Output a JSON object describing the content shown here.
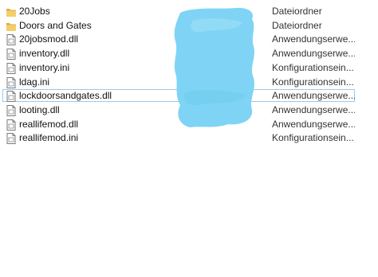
{
  "colors": {
    "folder": "#f3cf6c",
    "folder_dark": "#dcae3c",
    "file_border": "#7a7a7a",
    "selection_border": "#99c9ef",
    "redaction": "#7fd4f5"
  },
  "files": [
    {
      "name": "20Jobs",
      "type": "Dateiordner",
      "icon": "folder-icon"
    },
    {
      "name": "Doors and Gates",
      "type": "Dateiordner",
      "icon": "folder-icon"
    },
    {
      "name": "20jobsmod.dll",
      "type": "Anwendungserwe...",
      "icon": "dll-file-icon"
    },
    {
      "name": "inventory.dll",
      "type": "Anwendungserwe...",
      "icon": "dll-file-icon"
    },
    {
      "name": "inventory.ini",
      "type": "Konfigurationsein...",
      "icon": "ini-file-icon"
    },
    {
      "name": "ldag.ini",
      "type": "Konfigurationsein...",
      "icon": "ini-file-icon"
    },
    {
      "name": "lockdoorsandgates.dll",
      "type": "Anwendungserwe...",
      "icon": "dll-file-icon",
      "selected": true
    },
    {
      "name": "looting.dll",
      "type": "Anwendungserwe...",
      "icon": "dll-file-icon"
    },
    {
      "name": "reallifemod.dll",
      "type": "Anwendungserwe...",
      "icon": "dll-file-icon"
    },
    {
      "name": "reallifemod.ini",
      "type": "Konfigurationsein...",
      "icon": "ini-file-icon"
    }
  ]
}
